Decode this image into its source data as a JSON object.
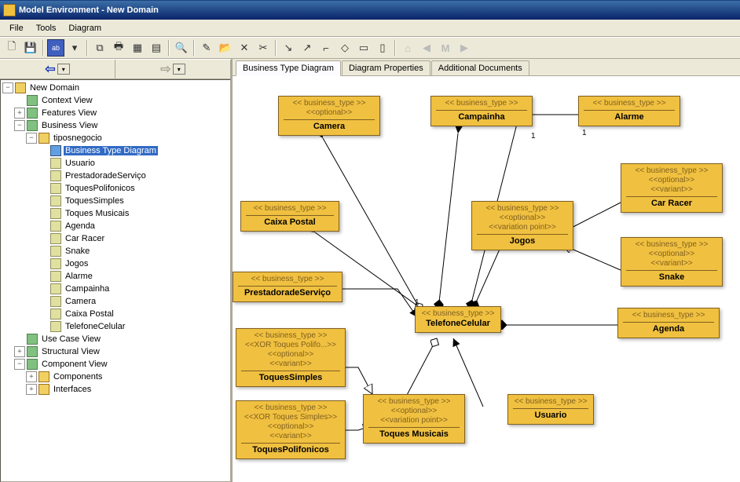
{
  "title": "Model Environment - New Domain",
  "menu": {
    "file": "File",
    "tools": "Tools",
    "diagram": "Diagram"
  },
  "nav": {
    "back": "⇦",
    "fwd": "⇨"
  },
  "tree": {
    "root": "New Domain",
    "context": "Context View",
    "features": "Features View",
    "business": "Business View",
    "tiposnegocio": "tiposnegocio",
    "btd": "Business Type Diagram",
    "items": [
      "Usuario",
      "PrestadoradeServiço",
      "ToquesPolifonicos",
      "ToquesSimples",
      "Toques Musicais",
      "Agenda",
      "Car Racer",
      "Snake",
      "Jogos",
      "Alarme",
      "Campainha",
      "Camera",
      "Caixa Postal",
      "TelefoneCelular"
    ],
    "usecase": "Use Case View",
    "structural": "Structural View",
    "component": "Component View",
    "components": "Components",
    "interfaces": "Interfaces"
  },
  "tabs": {
    "t1": "Business Type Diagram",
    "t2": "Diagram Properties",
    "t3": "Additional Documents"
  },
  "st": {
    "bt": "<< business_type >>",
    "opt": "<<optional>>",
    "var": "<<variant>>",
    "vp": "<<variation point>>",
    "xp": "<<XOR Toques Polifo...>>",
    "xs": "<<XOR Toques Simples>>"
  },
  "box": {
    "camera": "Camera",
    "campainha": "Campainha",
    "alarme": "Alarme",
    "carracer": "Car Racer",
    "caixa": "Caixa Postal",
    "jogos": "Jogos",
    "snake": "Snake",
    "prest": "PrestadoradeServiço",
    "tel": "TelefoneCelular",
    "agenda": "Agenda",
    "tsimples": "ToquesSimples",
    "tmusicais": "Toques Musicais",
    "usuario": "Usuario",
    "tpoli": "ToquesPolifonicos"
  },
  "lbl": {
    "one": "1"
  }
}
